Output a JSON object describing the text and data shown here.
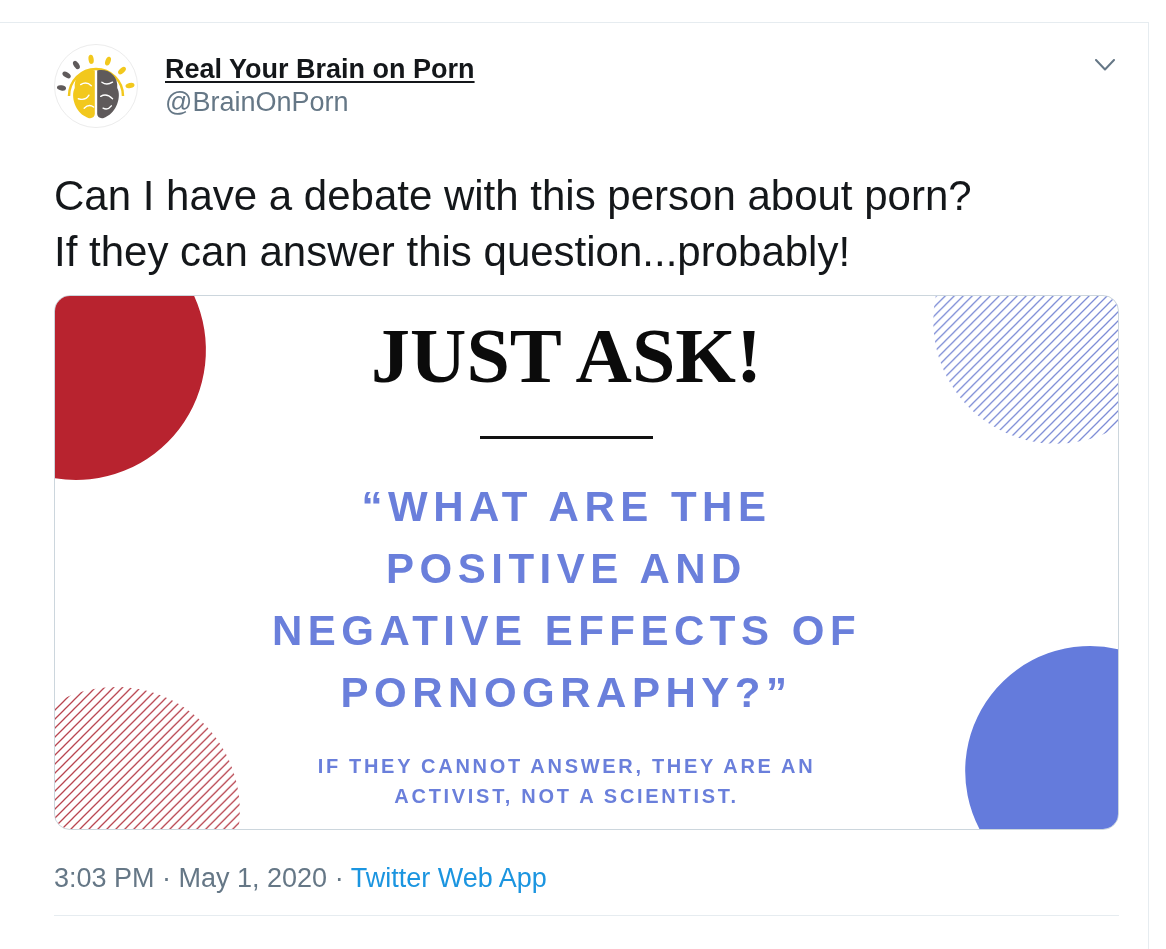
{
  "tweet": {
    "author": {
      "name": "Real Your Brain on Porn",
      "handle": "@BrainOnPorn"
    },
    "text": "Can I have a debate with this person about porn?\nIf they can answer this question...probably!",
    "image": {
      "headline": "JUST ASK!",
      "question": "“WHAT ARE THE\nPOSITIVE AND\nNEGATIVE EFFECTS OF\nPORNOGRAPHY?”",
      "note": "IF THEY CANNOT ANSWER, THEY ARE AN\nACTIVIST, NOT A SCIENTIST.",
      "shapes": [
        {
          "kind": "solid",
          "color": "#b8232f"
        },
        {
          "kind": "hatched",
          "color": "#7d8cd6"
        },
        {
          "kind": "hatched",
          "color": "#b8444f"
        },
        {
          "kind": "solid",
          "color": "#647bdc"
        }
      ]
    },
    "timestamp": "3:03 PM · May 1, 2020 ·",
    "source": "Twitter Web App"
  }
}
